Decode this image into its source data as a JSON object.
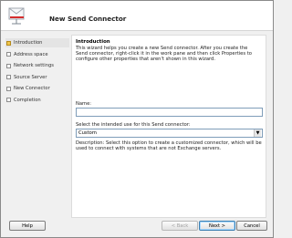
{
  "window": {
    "title": "New Send Connector"
  },
  "nav": {
    "items": [
      {
        "label": "Introduction",
        "active": true
      },
      {
        "label": "Address space",
        "active": false
      },
      {
        "label": "Network settings",
        "active": false
      },
      {
        "label": "Source Server",
        "active": false
      },
      {
        "label": "New Connector",
        "active": false
      },
      {
        "label": "Completion",
        "active": false
      }
    ]
  },
  "content": {
    "heading": "Introduction",
    "description": "This wizard helps you create a new Send connector. After you create the Send connector, right-click it in the work pane and then click Properties to configure other properties that aren't shown in this wizard.",
    "name_label": "Name:",
    "name_value": "",
    "intended_use_label": "Select the intended use for this Send connector:",
    "intended_use_value": "Custom",
    "intended_use_description": "Description: Select this option to create a customized connector, which will be used to connect with systems that are not Exchange servers."
  },
  "buttons": {
    "help": "Help",
    "back": "< Back",
    "next": "Next >",
    "cancel": "Cancel"
  }
}
